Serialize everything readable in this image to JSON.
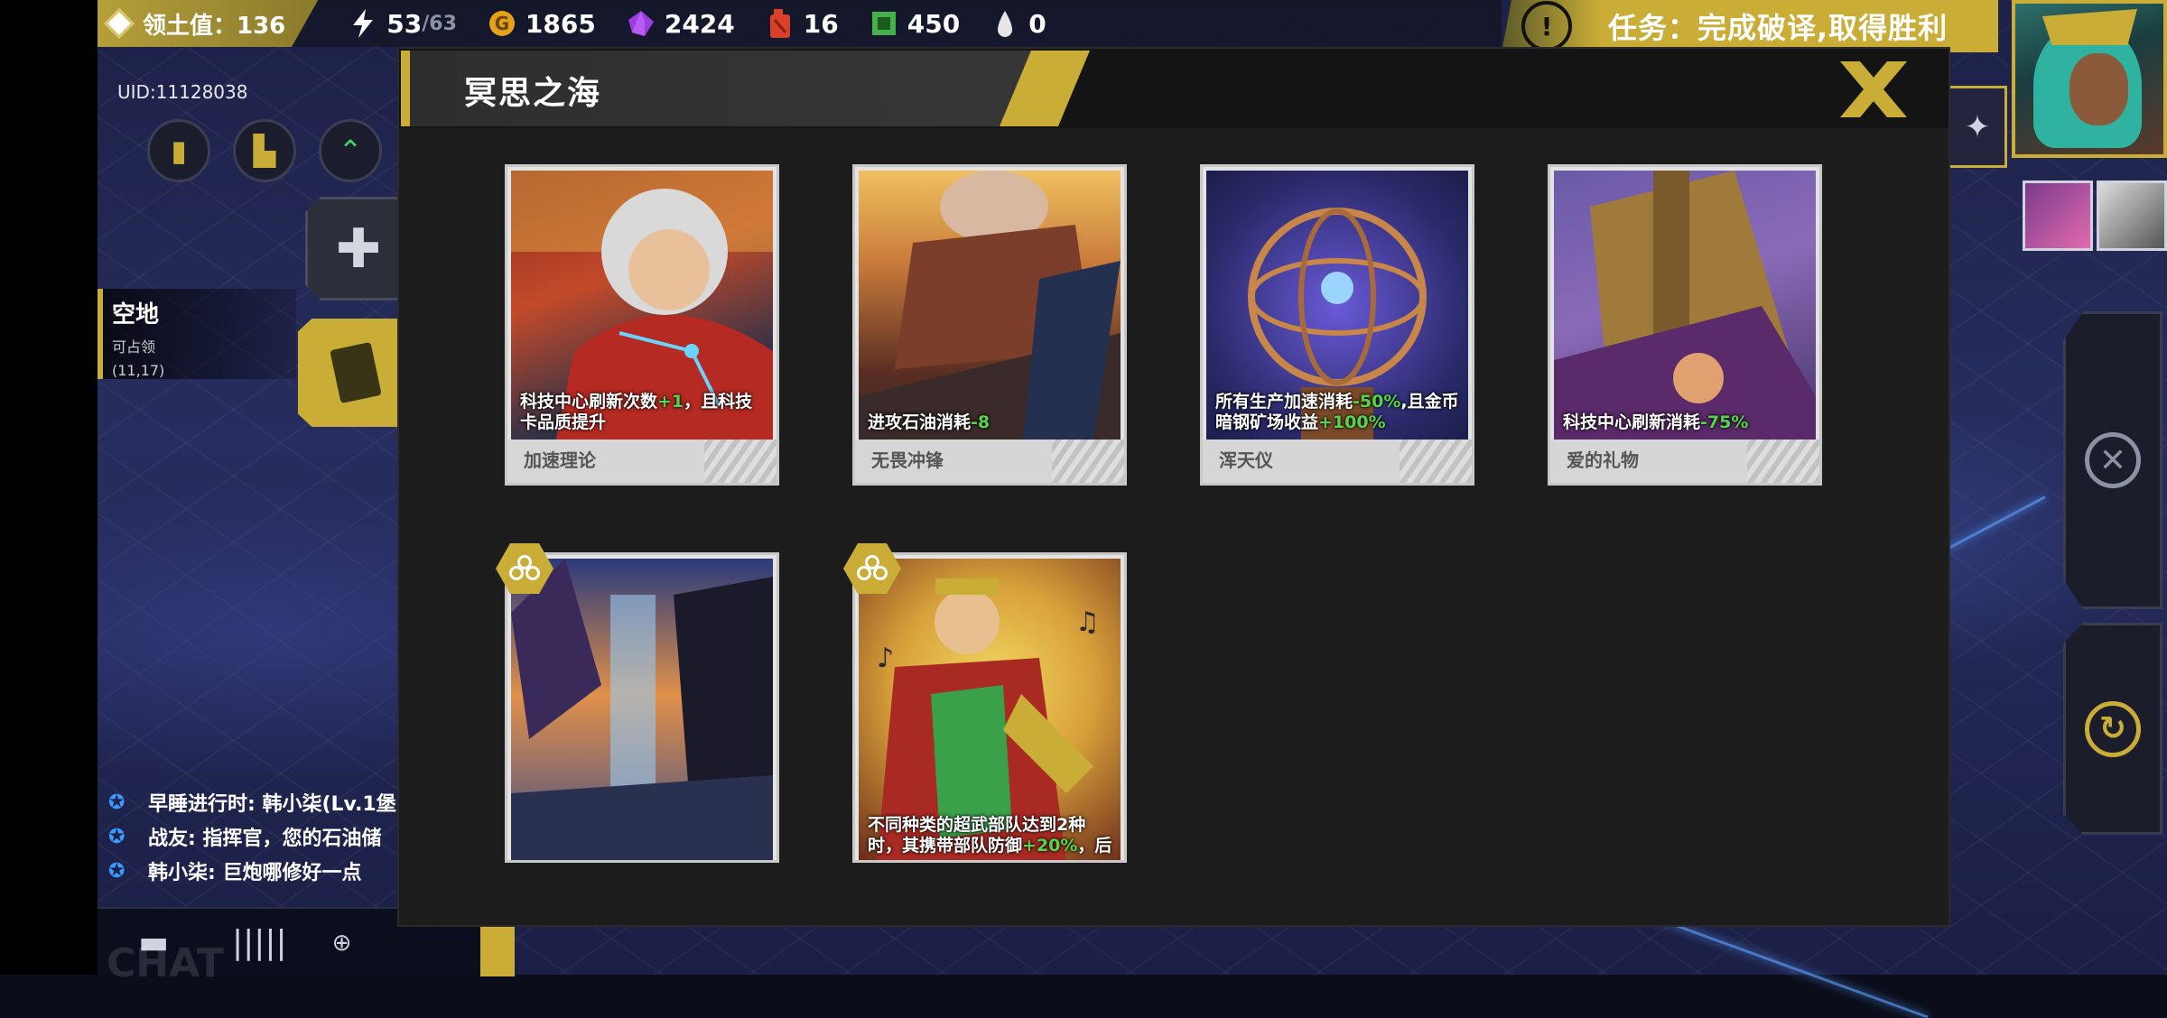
{
  "topbar": {
    "territory_label": "领土值：136",
    "energy_current": "53",
    "energy_max": "/63",
    "gold": "1865",
    "crystal": "2424",
    "oil": "16",
    "chips": "450",
    "drops": "0",
    "icons": [
      "territory-icon",
      "lightning-icon",
      "gold-coin-icon",
      "crystal-icon",
      "fuel-can-icon",
      "chip-icon",
      "drop-icon"
    ]
  },
  "mission": {
    "text": "任务：完成破译,取得胜利"
  },
  "left_panel": {
    "uid": "UID:11128038",
    "tile_name": "空地",
    "tile_status": "可占领",
    "tile_coords": "(11,17)"
  },
  "chat": {
    "lines": [
      "早睡进行时: 韩小柒(Lv.1堡",
      "战友: 指挥官，您的石油储",
      "韩小柒: 巨炮哪修好一点"
    ],
    "watermark": "CHAT"
  },
  "modal": {
    "title": "冥思之海",
    "cards": [
      {
        "name": "加速理论",
        "desc_parts": [
          "科技中心刷新次数",
          "+1",
          "，且科技卡品质提升"
        ]
      },
      {
        "name": "无畏冲锋",
        "desc_parts": [
          "进攻石油消耗",
          "-8",
          ""
        ]
      },
      {
        "name": "浑天仪",
        "desc_parts": [
          "所有生产加速消耗",
          "-50%",
          ",且金币暗钢矿场收益",
          "+100%"
        ]
      },
      {
        "name": "爱的礼物",
        "desc_parts": [
          "科技中心刷新消耗",
          "-75%",
          ""
        ]
      },
      {
        "name": "",
        "desc_parts": [
          "",
          "",
          ""
        ]
      },
      {
        "name": "",
        "desc_parts": [
          "不同种类的超武部队达到2种时，其携带部队防御",
          "+20%",
          "，后"
        ]
      }
    ]
  },
  "colors": {
    "gold_accent": "#c9ad36",
    "bonus_green": "#57d44a",
    "modal_bg": "#1c1c1c"
  }
}
